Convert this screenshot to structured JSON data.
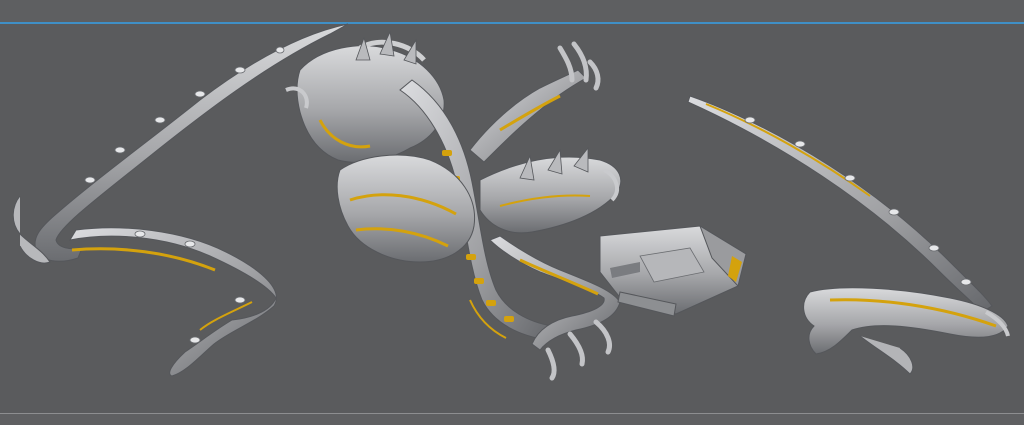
{
  "viewport": {
    "background": "#5a5b5d",
    "accent_line_color": "#3f8fc6",
    "bottom_line_color": "#8d8e90",
    "model_colors": {
      "mesh": "#a9aaad",
      "mesh_light": "#d7d8da",
      "mesh_shadow": "#6e7074",
      "highlight": "#d4a20d"
    },
    "objects": [
      "left-tail-segment",
      "creature-body",
      "right-tail-segment",
      "base-block"
    ]
  }
}
